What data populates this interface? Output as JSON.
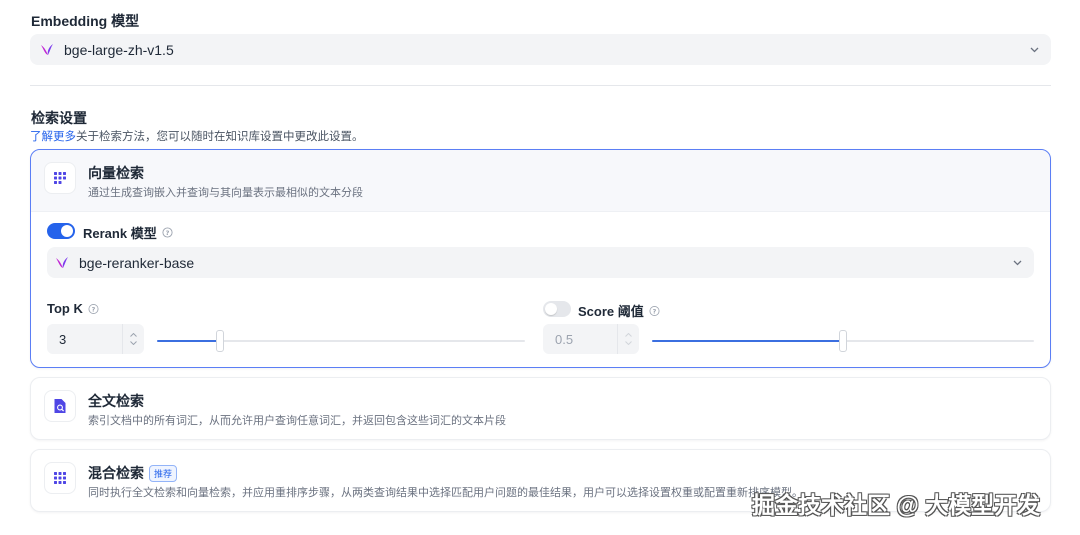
{
  "embedding": {
    "title": "Embedding 模型",
    "model": "bge-large-zh-v1.5",
    "model_icon": "model-logo-icon"
  },
  "retrieval": {
    "title": "检索设置",
    "learn_more": "了解更多",
    "description": "关于检索方法，您可以随时在知识库设置中更改此设置。",
    "methods": [
      {
        "name": "向量检索",
        "description": "通过生成查询嵌入并查询与其向量表示最相似的文本分段",
        "icon": "grid-dots-icon",
        "selected": true
      },
      {
        "name": "全文检索",
        "description": "索引文档中的所有词汇，从而允许用户查询任意词汇，并返回包含这些词汇的文本片段",
        "icon": "document-search-icon",
        "selected": false
      },
      {
        "name": "混合检索",
        "tag": "推荐",
        "description": "同时执行全文检索和向量检索，并应用重排序步骤，从两类查询结果中选择匹配用户问题的最佳结果，用户可以选择设置权重或配置重新排序模型。",
        "icon": "grid-dots-icon",
        "selected": false
      }
    ],
    "rerank": {
      "label": "Rerank 模型",
      "enabled": true,
      "model": "bge-reranker-base"
    },
    "top_k": {
      "label": "Top K",
      "value": "3",
      "slider_fraction": 0.17
    },
    "score_threshold": {
      "label": "Score 阈值",
      "enabled": false,
      "value": "0.5",
      "slider_fraction": 0.5
    }
  },
  "watermark": "掘金技术社区 @ 大模型开发",
  "colors": {
    "accent": "#2563eb",
    "selected_border": "#5b7ef5"
  }
}
